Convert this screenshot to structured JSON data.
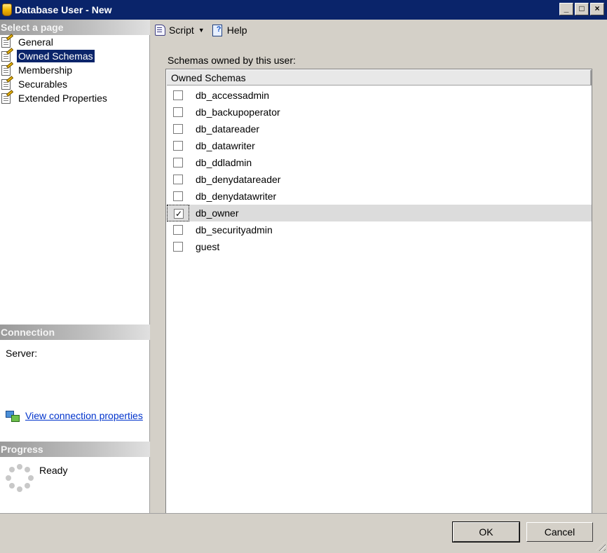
{
  "window": {
    "title": "Database User - New",
    "controls": {
      "minimize": "_",
      "maximize": "□",
      "close": "×"
    }
  },
  "sidebar": {
    "select_page_header": "Select a page",
    "pages": [
      {
        "label": "General",
        "icon": "properties-page-icon",
        "selected": false
      },
      {
        "label": "Owned Schemas",
        "icon": "properties-page-icon",
        "selected": true
      },
      {
        "label": "Membership",
        "icon": "properties-page-icon",
        "selected": false
      },
      {
        "label": "Securables",
        "icon": "properties-page-icon",
        "selected": false
      },
      {
        "label": "Extended Properties",
        "icon": "properties-page-icon",
        "selected": false
      }
    ],
    "connection_header": "Connection",
    "server_label": "Server:",
    "connection_link": "View connection properties",
    "progress_header": "Progress",
    "progress_status": "Ready"
  },
  "toolbar": {
    "script_label": "Script",
    "script_arrow": "▼",
    "help_label": "Help"
  },
  "main": {
    "caption": "Schemas owned by this user:",
    "grid": {
      "column_header": "Owned Schemas",
      "rows": [
        {
          "name": "db_accessadmin",
          "checked": false
        },
        {
          "name": "db_backupoperator",
          "checked": false
        },
        {
          "name": "db_datareader",
          "checked": false
        },
        {
          "name": "db_datawriter",
          "checked": false
        },
        {
          "name": "db_ddladmin",
          "checked": false
        },
        {
          "name": "db_denydatareader",
          "checked": false
        },
        {
          "name": "db_denydatawriter",
          "checked": false
        },
        {
          "name": "db_owner",
          "checked": true
        },
        {
          "name": "db_securityadmin",
          "checked": false
        },
        {
          "name": "guest",
          "checked": false
        }
      ],
      "check_glyph": "✓"
    }
  },
  "buttons": {
    "ok": "OK",
    "cancel": "Cancel"
  },
  "colors": {
    "titlebar": "#0a246a",
    "selection": "#0a246a",
    "link": "#0033cc",
    "dialog_face": "#d4d0c8"
  }
}
